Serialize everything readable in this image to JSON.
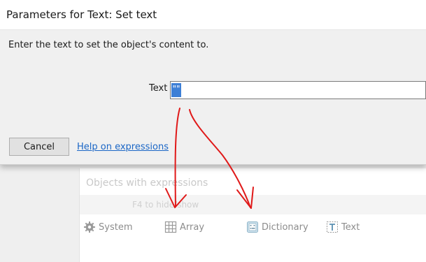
{
  "dialog": {
    "title": "Parameters for Text: Set text",
    "instruction": "Enter the text to set the object's content to.",
    "field_label": "Text",
    "field_value": "\"\"",
    "cancel_label": "Cancel",
    "help_link": "Help on expressions"
  },
  "background_panel": {
    "title": "Objects with expressions",
    "hint": "F4 to hide/show",
    "tabs": [
      {
        "label": "System",
        "icon": "gear-icon"
      },
      {
        "label": "Array",
        "icon": "grid-icon"
      },
      {
        "label": "Dictionary",
        "icon": "binary-icon"
      },
      {
        "label": "Text",
        "icon": "text-t-icon"
      }
    ]
  },
  "colors": {
    "dialog_bg": "#f0f0f0",
    "link": "#1a66c6",
    "selection": "#3d7fd6",
    "annotation_arrow": "#e01919"
  }
}
